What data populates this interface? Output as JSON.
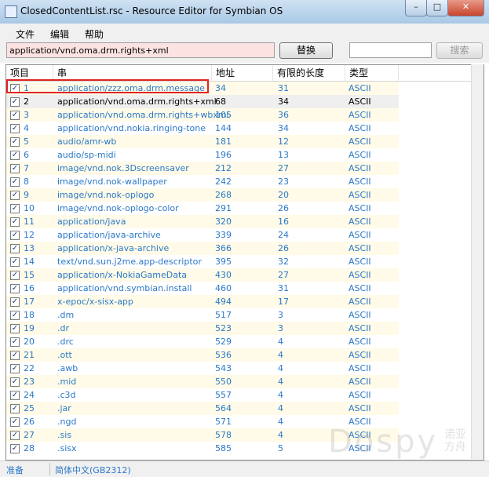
{
  "window": {
    "title": "ClosedContentList.rsc - Resource Editor for Symbian OS",
    "min_glyph": "–",
    "max_glyph": "□",
    "close_glyph": "✕"
  },
  "menu": [
    "文件",
    "编辑",
    "帮助"
  ],
  "toolbar": {
    "replace_value": "application/vnd.oma.drm.rights+xml",
    "replace_button": "替换",
    "search_value": "",
    "search_button": "搜索"
  },
  "columns": [
    "项目",
    "串",
    "地址",
    "有限的长度",
    "类型"
  ],
  "selected_row": 2,
  "highlighted_row": 1,
  "rows": [
    {
      "id": "1",
      "string": "application/zzz.oma.drm.message",
      "addr": "34",
      "len": "31",
      "type": "ASCII"
    },
    {
      "id": "2",
      "string": "application/vnd.oma.drm.rights+xml",
      "addr": "68",
      "len": "34",
      "type": "ASCII"
    },
    {
      "id": "3",
      "string": "application/vnd.oma.drm.rights+wbxml",
      "addr": "105",
      "len": "36",
      "type": "ASCII"
    },
    {
      "id": "4",
      "string": "application/vnd.nokia.ringing-tone",
      "addr": "144",
      "len": "34",
      "type": "ASCII"
    },
    {
      "id": "5",
      "string": "audio/amr-wb",
      "addr": "181",
      "len": "12",
      "type": "ASCII"
    },
    {
      "id": "6",
      "string": "audio/sp-midi",
      "addr": "196",
      "len": "13",
      "type": "ASCII"
    },
    {
      "id": "7",
      "string": "image/vnd.nok.3Dscreensaver",
      "addr": "212",
      "len": "27",
      "type": "ASCII"
    },
    {
      "id": "8",
      "string": "image/vnd.nok-wallpaper",
      "addr": "242",
      "len": "23",
      "type": "ASCII"
    },
    {
      "id": "9",
      "string": "image/vnd.nok-oplogo",
      "addr": "268",
      "len": "20",
      "type": "ASCII"
    },
    {
      "id": "10",
      "string": "image/vnd.nok-oplogo-color",
      "addr": "291",
      "len": "26",
      "type": "ASCII"
    },
    {
      "id": "11",
      "string": "application/java",
      "addr": "320",
      "len": "16",
      "type": "ASCII"
    },
    {
      "id": "12",
      "string": "application/java-archive",
      "addr": "339",
      "len": "24",
      "type": "ASCII"
    },
    {
      "id": "13",
      "string": "application/x-java-archive",
      "addr": "366",
      "len": "26",
      "type": "ASCII"
    },
    {
      "id": "14",
      "string": "text/vnd.sun.j2me.app-descriptor",
      "addr": "395",
      "len": "32",
      "type": "ASCII"
    },
    {
      "id": "15",
      "string": "application/x-NokiaGameData",
      "addr": "430",
      "len": "27",
      "type": "ASCII"
    },
    {
      "id": "16",
      "string": "application/vnd.symbian.install",
      "addr": "460",
      "len": "31",
      "type": "ASCII"
    },
    {
      "id": "17",
      "string": "x-epoc/x-sisx-app",
      "addr": "494",
      "len": "17",
      "type": "ASCII"
    },
    {
      "id": "18",
      "string": ".dm",
      "addr": "517",
      "len": "3",
      "type": "ASCII"
    },
    {
      "id": "19",
      "string": ".dr",
      "addr": "523",
      "len": "3",
      "type": "ASCII"
    },
    {
      "id": "20",
      "string": ".drc",
      "addr": "529",
      "len": "4",
      "type": "ASCII"
    },
    {
      "id": "21",
      "string": ".ott",
      "addr": "536",
      "len": "4",
      "type": "ASCII"
    },
    {
      "id": "22",
      "string": ".awb",
      "addr": "543",
      "len": "4",
      "type": "ASCII"
    },
    {
      "id": "23",
      "string": ".mid",
      "addr": "550",
      "len": "4",
      "type": "ASCII"
    },
    {
      "id": "24",
      "string": ".c3d",
      "addr": "557",
      "len": "4",
      "type": "ASCII"
    },
    {
      "id": "25",
      "string": ".jar",
      "addr": "564",
      "len": "4",
      "type": "ASCII"
    },
    {
      "id": "26",
      "string": ".ngd",
      "addr": "571",
      "len": "4",
      "type": "ASCII"
    },
    {
      "id": "27",
      "string": ".sis",
      "addr": "578",
      "len": "4",
      "type": "ASCII"
    },
    {
      "id": "28",
      "string": ".sisx",
      "addr": "585",
      "len": "5",
      "type": "ASCII"
    }
  ],
  "status": {
    "state": "准备",
    "encoding": "简体中文(GB2312)"
  },
  "watermark": {
    "brand": "Dospy",
    "cn": "诺亚方舟"
  },
  "colors": {
    "link_text": "#2b78c8",
    "highlight_border": "#e02424",
    "odd_row": "#fffbe8"
  }
}
